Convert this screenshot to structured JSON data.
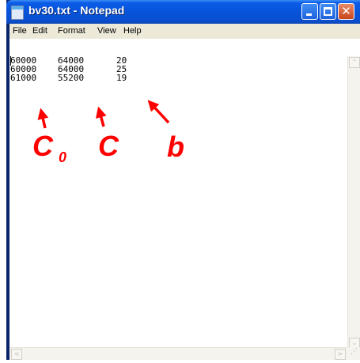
{
  "window": {
    "title": "bv30.txt - Notepad",
    "close_glyph": "✕"
  },
  "menu": {
    "items": [
      "File",
      "Edit",
      "Format",
      "View",
      "Help"
    ]
  },
  "document": {
    "lines": [
      [
        "60000",
        "64000",
        "20"
      ],
      [
        "60000",
        "64000",
        "25"
      ],
      [
        "61000",
        "55200",
        "19"
      ]
    ]
  },
  "scrollbar_glyphs": {
    "up": "⌃",
    "down": "⌄",
    "left": "<",
    "right": ">"
  },
  "annotations": {
    "color": "#ff0000",
    "col1_label": "C",
    "col1_subscript": "0",
    "col2_label": "C",
    "col3_label": "b"
  }
}
